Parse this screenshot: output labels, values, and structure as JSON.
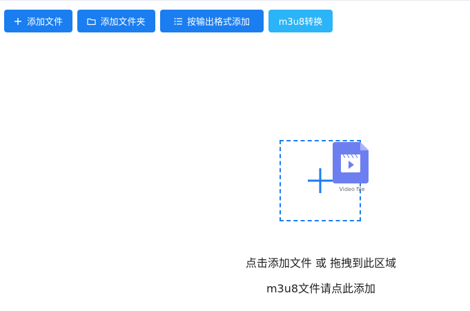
{
  "toolbar": {
    "add_file_label": "添加文件",
    "add_folder_label": "添加文件夹",
    "add_by_format_label": "按输出格式添加",
    "m3u8_convert_label": "m3u8转换"
  },
  "icons": {
    "add_file": "plus-icon",
    "add_folder": "folder-icon",
    "add_by_format": "list-icon",
    "drop_zone_plus": "plus-icon",
    "drop_zone_file": "video-file-icon"
  },
  "drop_zone": {
    "file_caption": "Video file",
    "hint_primary": "点击添加文件 或 拖拽到此区域",
    "hint_secondary": "m3u8文件请点此添加"
  },
  "colors": {
    "primary": "#1a7df0",
    "secondary": "#2bb4f7",
    "file_icon": "#6d7ff0",
    "file_icon_fold": "#aab5f7"
  }
}
